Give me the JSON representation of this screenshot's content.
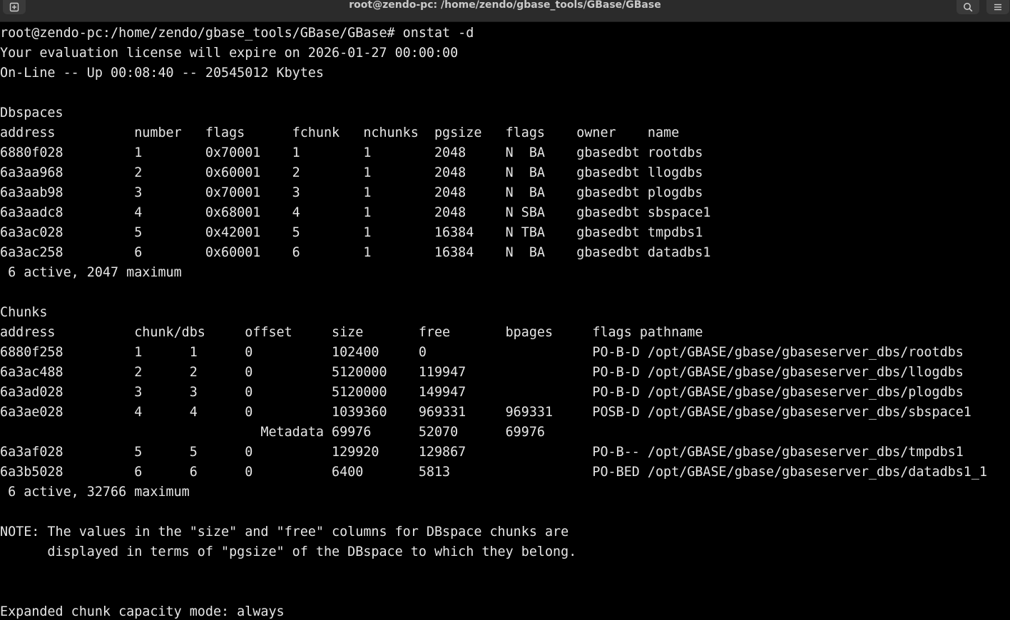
{
  "window": {
    "title": "root@zendo-pc: /home/zendo/gbase_tools/GBase/GBase",
    "icons": [
      "new-tab-icon",
      "search-icon",
      "hamburger-menu-icon"
    ]
  },
  "colors": {
    "background": "#000000",
    "foreground": "#e6e6e6",
    "titlebar": "#2b2b2b"
  },
  "terminal": {
    "lines": [
      "root@zendo-pc:/home/zendo/gbase_tools/GBase/GBase# onstat -d",
      "Your evaluation license will expire on 2026-01-27 00:00:00",
      "On-Line -- Up 00:08:40 -- 20545012 Kbytes",
      "",
      "Dbspaces",
      "address          number   flags      fchunk   nchunks  pgsize   flags    owner    name",
      "6880f028         1        0x70001    1        1        2048     N  BA    gbasedbt rootdbs",
      "6a3aa968         2        0x60001    2        1        2048     N  BA    gbasedbt llogdbs",
      "6a3aab98         3        0x70001    3        1        2048     N  BA    gbasedbt plogdbs",
      "6a3aadc8         4        0x68001    4        1        2048     N SBA    gbasedbt sbspace1",
      "6a3ac028         5        0x42001    5        1        16384    N TBA    gbasedbt tmpdbs1",
      "6a3ac258         6        0x60001    6        1        16384    N  BA    gbasedbt datadbs1",
      " 6 active, 2047 maximum",
      "",
      "Chunks",
      "address          chunk/dbs     offset     size       free       bpages     flags pathname",
      "6880f258         1      1      0          102400     0                     PO-B-D /opt/GBASE/gbase/gbaseserver_dbs/rootdbs",
      "6a3ac488         2      2      0          5120000    119947                PO-B-D /opt/GBASE/gbase/gbaseserver_dbs/llogdbs",
      "6a3ad028         3      3      0          5120000    149947                PO-B-D /opt/GBASE/gbase/gbaseserver_dbs/plogdbs",
      "6a3ae028         4      4      0          1039360    969331     969331     POSB-D /opt/GBASE/gbase/gbaseserver_dbs/sbspace1",
      "                                 Metadata 69976      52070      69976",
      "6a3af028         5      5      0          129920     129867                PO-B-- /opt/GBASE/gbase/gbaseserver_dbs/tmpdbs1",
      "6a3b5028         6      6      0          6400       5813                  PO-BED /opt/GBASE/gbase/gbaseserver_dbs/datadbs1_1",
      " 6 active, 32766 maximum",
      "",
      "NOTE: The values in the \"size\" and \"free\" columns for DBspace chunks are",
      "      displayed in terms of \"pgsize\" of the DBspace to which they belong.",
      "",
      "",
      "Expanded chunk capacity mode: always"
    ]
  }
}
